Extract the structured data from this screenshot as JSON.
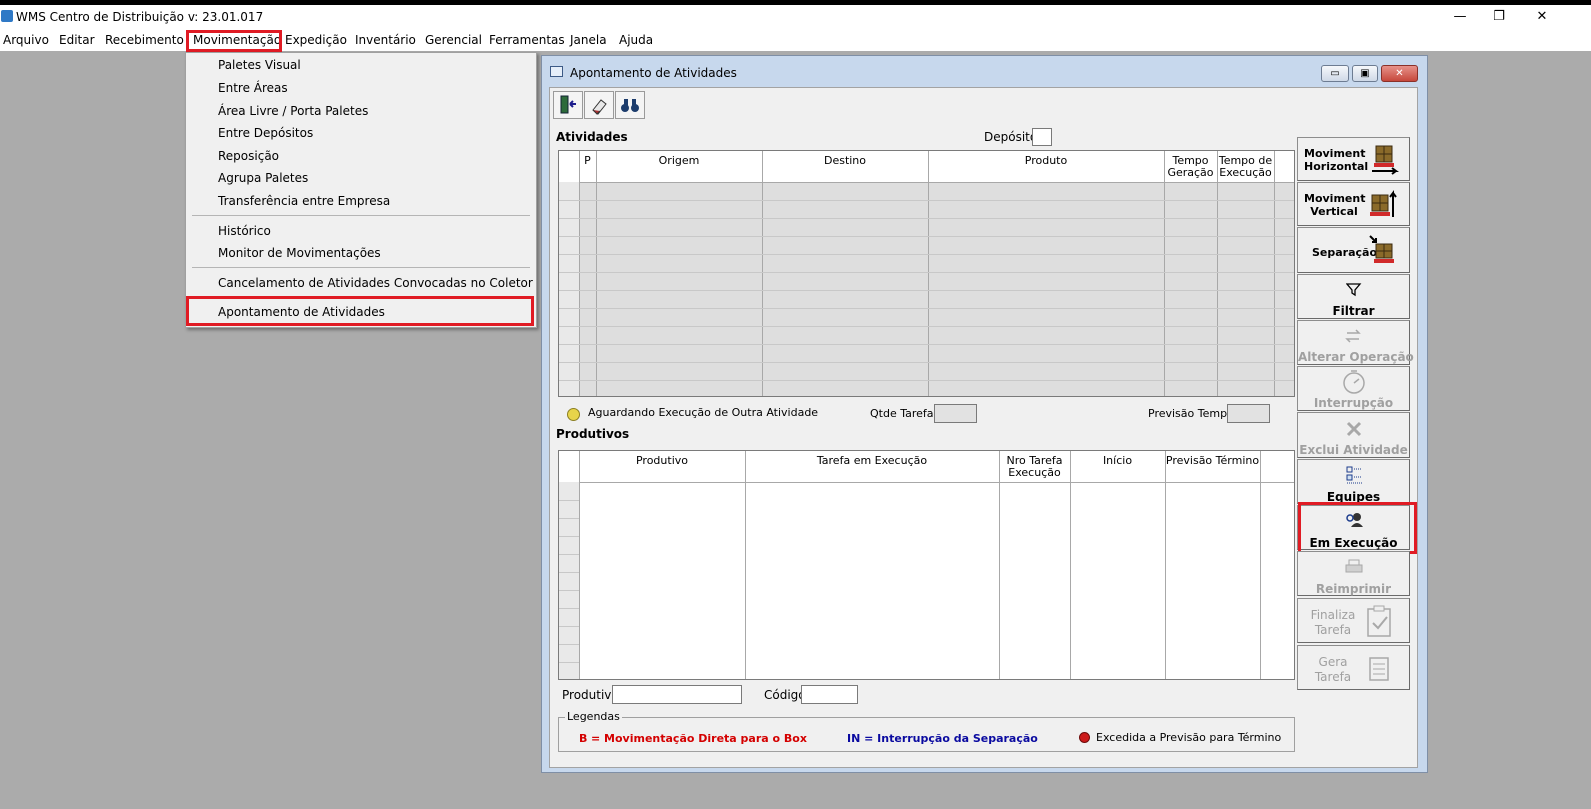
{
  "app": {
    "title": "WMS Centro de Distribuição  v: 23.01.017"
  },
  "window_controls": {
    "minimize": "—",
    "restore": "❐",
    "close": "✕"
  },
  "menubar": {
    "items": [
      "Arquivo",
      "Editar",
      "Recebimento",
      "Movimentação",
      "Expedição",
      "Inventário",
      "Gerencial",
      "Ferramentas",
      "Janela",
      "Ajuda"
    ],
    "active": "Movimentação"
  },
  "dropdown": {
    "items": [
      "Paletes Visual",
      "Entre  Áreas",
      "Área Livre / Porta Paletes",
      "Entre Depósitos",
      "Reposição",
      "Agrupa Paletes",
      "Transferência entre Empresa",
      "Histórico",
      "Monitor de Movimentações",
      "Cancelamento de Atividades Convocadas no Coletor",
      "Apontamento de Atividades"
    ],
    "highlighted": "Apontamento de Atividades"
  },
  "child_window": {
    "title": "Apontamento de Atividades",
    "controls": {
      "minimize": "▭",
      "restore": "▣",
      "close": "✕"
    },
    "toolbar": [
      "exit-icon",
      "eraser-icon",
      "binoculars-icon"
    ]
  },
  "atividades": {
    "label": "Atividades",
    "deposito_label": "Depósito",
    "deposito_value": "",
    "columns": [
      "P",
      "Origem",
      "Destino",
      "Produto",
      "Tempo Geração",
      "Tempo de Execução"
    ],
    "rows": []
  },
  "status_line": {
    "legend_text": "Aguardando Execução de Outra Atividade",
    "qtde_label": "Qtde Tarefas",
    "qtde_value": "",
    "previsao_label": "Previsão Tempo",
    "previsao_value": ""
  },
  "produtivos": {
    "label": "Produtivos",
    "columns": [
      "Produtivo",
      "Tarefa em Execução",
      "Nro Tarefa Execução",
      "Início",
      "Previsão Término"
    ],
    "rows": []
  },
  "filters": {
    "produtivo_label": "Produtivo",
    "produtivo_value": "",
    "codigo_label": "Código",
    "codigo_value": ""
  },
  "legendas": {
    "title": "Legendas",
    "b_symbol": "B",
    "b_text": "= Movimentação Direta para o Box",
    "in_text": "IN = Interrupção da Separação",
    "excedida_text": "Excedida a Previsão para Término",
    "colors": {
      "b": "#d40000",
      "in": "#0a0aa0"
    }
  },
  "side_buttons": {
    "mov_horizontal": "Moviment Horizontal",
    "mov_vertical": "Moviment Vertical",
    "separacao": "Separação",
    "filtrar": "Filtrar",
    "alterar_operacao": "Alterar Operação",
    "interrupcao": "Interrupção",
    "exclui_atividade": "Exclui Atividade",
    "equipes": "Equipes",
    "em_execucao": "Em Execução",
    "reimprimir": "Reimprimir",
    "finaliza_tarefa": "Finaliza Tarefa",
    "gera_tarefa": "Gera Tarefa"
  },
  "accent": {
    "highlight": "#e01b24"
  }
}
